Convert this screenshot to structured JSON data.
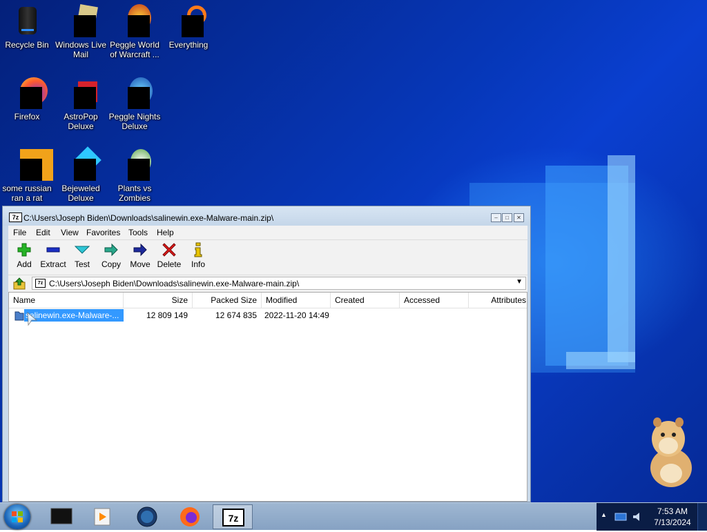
{
  "desktop": {
    "icons": [
      {
        "label": "Recycle Bin"
      },
      {
        "label": "Windows Live Mail"
      },
      {
        "label": "Peggle World of Warcraft ..."
      },
      {
        "label": "Everything"
      },
      {
        "label": "Firefox"
      },
      {
        "label": "AstroPop Deluxe"
      },
      {
        "label": "Peggle Nights Deluxe"
      },
      {
        "label": "some russian ran a rat"
      },
      {
        "label": "Bejeweled Deluxe"
      },
      {
        "label": "Plants vs Zombies"
      }
    ]
  },
  "window": {
    "app_icon": "7z",
    "title": "C:\\Users\\Joseph Biden\\Downloads\\salinewin.exe-Malware-main.zip\\",
    "menu": [
      "File",
      "Edit",
      "View",
      "Favorites",
      "Tools",
      "Help"
    ],
    "toolbar": [
      "Add",
      "Extract",
      "Test",
      "Copy",
      "Move",
      "Delete",
      "Info"
    ],
    "address": "C:\\Users\\Joseph Biden\\Downloads\\salinewin.exe-Malware-main.zip\\",
    "columns": [
      "Name",
      "Size",
      "Packed Size",
      "Modified",
      "Created",
      "Accessed",
      "Attributes"
    ],
    "rows": [
      {
        "name": "salinewin.exe-Malware-...",
        "size": "12 809 149",
        "packed_size": "12 674 835",
        "modified": "2022-11-20 14:49",
        "created": "",
        "accessed": "",
        "attributes": ""
      }
    ]
  },
  "taskbar": {
    "start_icon": "windows-orb-icon",
    "items": [
      "media-center-icon",
      "media-player-icon",
      "browser-globe-icon",
      "firefox-icon",
      "7zip-icon"
    ],
    "time": "7:53 AM",
    "date": "7/13/2024"
  },
  "colors": {
    "selection": "#3399ff",
    "desktop": "#0637b8",
    "taskbar": "#86a2c3"
  }
}
